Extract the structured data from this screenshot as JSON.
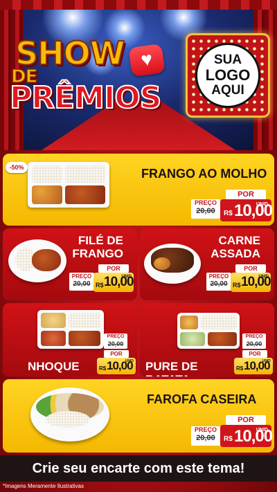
{
  "hero": {
    "title_show": "SHOW",
    "title_de": "DE",
    "title_premios": "PRÊMIOS",
    "logo_line1": "SUA",
    "logo_line2": "LOGO",
    "logo_line3": "AQUI",
    "heart_icon": "heart-icon"
  },
  "badge": "-50%",
  "products": [
    {
      "name": "FRANGO AO MOLHO",
      "preco_label": "PREÇO",
      "old_price": "20,00",
      "por_label": "POR",
      "currency": "R$",
      "price": "10,00",
      "unit": "UNID"
    },
    {
      "name_line1": "FILÉ DE",
      "name_line2": "FRANGO",
      "preco_label": "PREÇO",
      "old_price": "20,00",
      "por_label": "POR",
      "currency": "R$",
      "price": "10,00",
      "unit": "UNID"
    },
    {
      "name_line1": "CARNE",
      "name_line2": "ASSADA",
      "preco_label": "PREÇO",
      "old_price": "20,00",
      "por_label": "POR",
      "currency": "R$",
      "price": "10,00",
      "unit": "UNID"
    },
    {
      "name": "NHOQUE",
      "preco_label": "PREÇO",
      "old_price": "20,00",
      "por_label": "POR",
      "currency": "R$",
      "price": "10,00",
      "unit": "UNID"
    },
    {
      "name": "PURE DE BATATA",
      "preco_label": "PREÇO",
      "old_price": "20,00",
      "por_label": "POR",
      "currency": "R$",
      "price": "10,00",
      "unit": "UNID"
    },
    {
      "name": "FAROFA CASEIRA",
      "preco_label": "PREÇO",
      "old_price": "20,00",
      "por_label": "POR",
      "currency": "R$",
      "price": "10,00",
      "unit": "UNID"
    }
  ],
  "cta": "Crie seu encarte com este tema!",
  "footnote": "*Imagens Meramente Ilustrativas",
  "colors": {
    "brand_red": "#c0141a",
    "brand_yellow": "#f4b800"
  }
}
